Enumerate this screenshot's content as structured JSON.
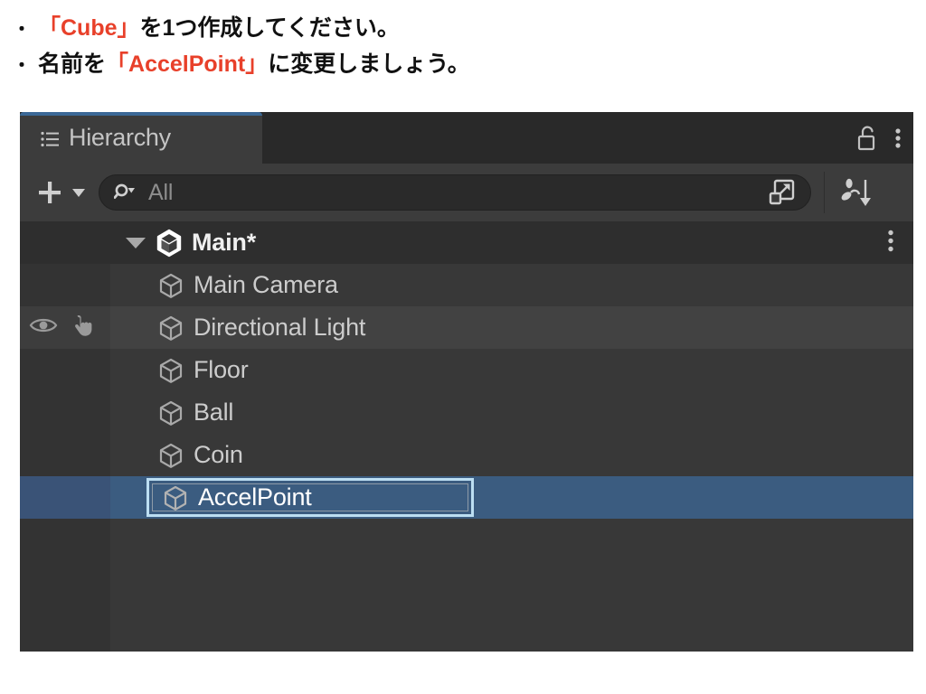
{
  "instructions": {
    "lines": [
      {
        "bullet": "・",
        "segments": [
          {
            "text": "「Cube」",
            "color": "red"
          },
          {
            "text": "を1つ作成してください。",
            "color": "black"
          }
        ]
      },
      {
        "bullet": "・",
        "segments": [
          {
            "text": "名前を",
            "color": "black"
          },
          {
            "text": "「AccelPoint」",
            "color": "red"
          },
          {
            "text": "に変更しましょう。",
            "color": "black"
          }
        ]
      }
    ],
    "accent_color": "#e8402a",
    "text_color": "#111111"
  },
  "panel": {
    "tab": {
      "label": "Hierarchy",
      "icon": "hierarchy-list-icon",
      "accent_color": "#3b6896",
      "active": true
    },
    "header_actions": [
      {
        "name": "lock-icon",
        "label": "Lock",
        "state": "unlocked"
      },
      {
        "name": "kebab-menu-icon",
        "label": "More options"
      }
    ],
    "toolbar": {
      "create_button": {
        "label": "+",
        "icon": "plus-icon",
        "dropdown": "chevron-down-icon"
      },
      "search": {
        "placeholder": "All",
        "value": "",
        "icon": "search-icon",
        "filter_dropdown": "search-filter-caret"
      },
      "open_in_window_icon": "open-in-new-window-icon",
      "sort_icon": "alphabetical-sort-descending-icon"
    },
    "scene": {
      "name": "Main*",
      "icon": "unity-scene-icon",
      "expanded": true,
      "disclosure_icon": "triangle-down-icon",
      "kebab_icon": "kebab-menu-icon"
    },
    "objects": [
      {
        "name": "Main Camera",
        "icon": "gameobject-cube-icon",
        "selected": false,
        "hover": false,
        "renaming": false,
        "visibility_icon": null,
        "pickability_icon": null
      },
      {
        "name": "Directional Light",
        "icon": "gameobject-cube-icon",
        "selected": false,
        "hover": true,
        "renaming": false,
        "visibility_icon": "eye-icon",
        "pickability_icon": "hand-pointer-icon"
      },
      {
        "name": "Floor",
        "icon": "gameobject-cube-icon",
        "selected": false,
        "hover": false,
        "renaming": false,
        "visibility_icon": null,
        "pickability_icon": null
      },
      {
        "name": "Ball",
        "icon": "gameobject-cube-icon",
        "selected": false,
        "hover": false,
        "renaming": false,
        "visibility_icon": null,
        "pickability_icon": null
      },
      {
        "name": "Coin",
        "icon": "gameobject-cube-icon",
        "selected": false,
        "hover": false,
        "renaming": false,
        "visibility_icon": null,
        "pickability_icon": null
      },
      {
        "name": "AccelPoint",
        "icon": "gameobject-cube-icon",
        "selected": true,
        "hover": false,
        "renaming": true,
        "visibility_icon": null,
        "pickability_icon": null
      }
    ],
    "colors": {
      "panel_bg": "#383838",
      "tabstrip_bg": "#292929",
      "tab_bg": "#3c3c3c",
      "gutter_bg": "#333333",
      "scene_row_bg": "#2e2e2e",
      "hover_row_bg": "#424242",
      "selection_bg": "#3b5c80",
      "rename_outline": "#bcdef2",
      "label_color": "#cccccc"
    }
  }
}
